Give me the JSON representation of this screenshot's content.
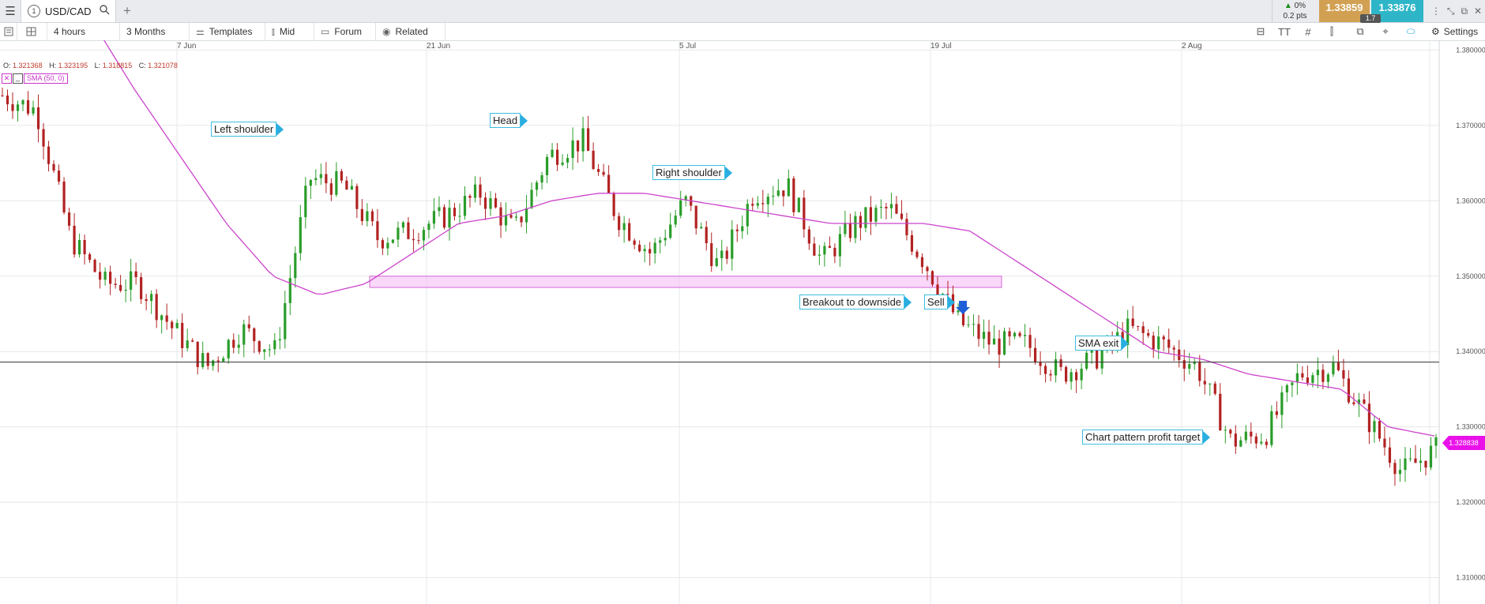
{
  "tabbar": {
    "tab_number": "1",
    "symbol": "USD/CAD",
    "add_tab": "+",
    "change_pct": "0%",
    "change_pts": "0.2 pts",
    "sell_price": "1.33859",
    "buy_price": "1.33876",
    "spread": "1.7"
  },
  "toolbar": {
    "interval": "4 hours",
    "range": "3 Months",
    "templates": "Templates",
    "price_type": "Mid",
    "forum": "Forum",
    "related": "Related",
    "settings": "Settings"
  },
  "chart": {
    "ohlc": {
      "o_label": "O:",
      "o": "1.321368",
      "h_label": "H:",
      "h": "1.323195",
      "l_label": "L:",
      "l": "1.318815",
      "c_label": "C:",
      "c": "1.321078"
    },
    "indicator": "SMA (50, 0)",
    "current_price": "1.328838",
    "date_labels": [
      "7 Jun",
      "21 Jun",
      "5 Jul",
      "19 Jul",
      "2 Aug"
    ],
    "price_labels": [
      "1.380000",
      "1.370000",
      "1.360000",
      "1.350000",
      "1.340000",
      "1.330000",
      "1.320000",
      "1.310000"
    ],
    "annotations": {
      "left_shoulder": "Left shoulder",
      "head": "Head",
      "right_shoulder": "Right shoulder",
      "breakout": "Breakout to downside",
      "sell": "Sell",
      "sma_exit": "SMA exit",
      "profit_target": "Chart pattern profit target"
    },
    "colors": {
      "up": "#2a9d2a",
      "down": "#b22222",
      "sma": "#cc44cc",
      "neckline": "#f4b8f4",
      "accent": "#2aaee0"
    }
  },
  "chart_data": {
    "type": "candlestick",
    "title": "",
    "xlabel": "",
    "ylabel": "",
    "x_ticks": [
      "7 Jun",
      "21 Jun",
      "5 Jul",
      "19 Jul",
      "2 Aug"
    ],
    "ylim": [
      1.3065,
      1.3813
    ],
    "series": [
      {
        "type": "line",
        "values": [
          1.385,
          1.375,
          1.366,
          1.357,
          1.35,
          1.3475,
          1.349,
          1.353,
          1.357,
          1.358,
          1.36,
          1.361,
          1.361,
          1.36,
          1.359,
          1.358,
          1.357,
          1.357,
          1.357,
          1.356,
          1.352,
          1.348,
          1.344,
          1.34,
          1.339,
          1.337,
          1.336,
          1.335,
          1.33,
          1.3288
        ]
      },
      {
        "type": "close",
        "values": [
          1.374,
          1.372,
          1.355,
          1.349,
          1.349,
          1.343,
          1.338,
          1.343,
          1.34,
          1.363,
          1.362,
          1.355,
          1.356,
          1.358,
          1.361,
          1.356,
          1.366,
          1.368,
          1.358,
          1.353,
          1.36,
          1.351,
          1.361,
          1.362,
          1.352,
          1.357,
          1.359,
          1.352,
          1.344,
          1.341,
          1.341,
          1.337,
          1.339,
          1.343,
          1.341,
          1.338,
          1.328,
          1.329,
          1.337,
          1.338,
          1.331,
          1.324,
          1.327
        ]
      }
    ],
    "horizontal_line": 1.3386,
    "neckline_band": [
      1.3485,
      1.35
    ],
    "current_price": 1.328838
  }
}
